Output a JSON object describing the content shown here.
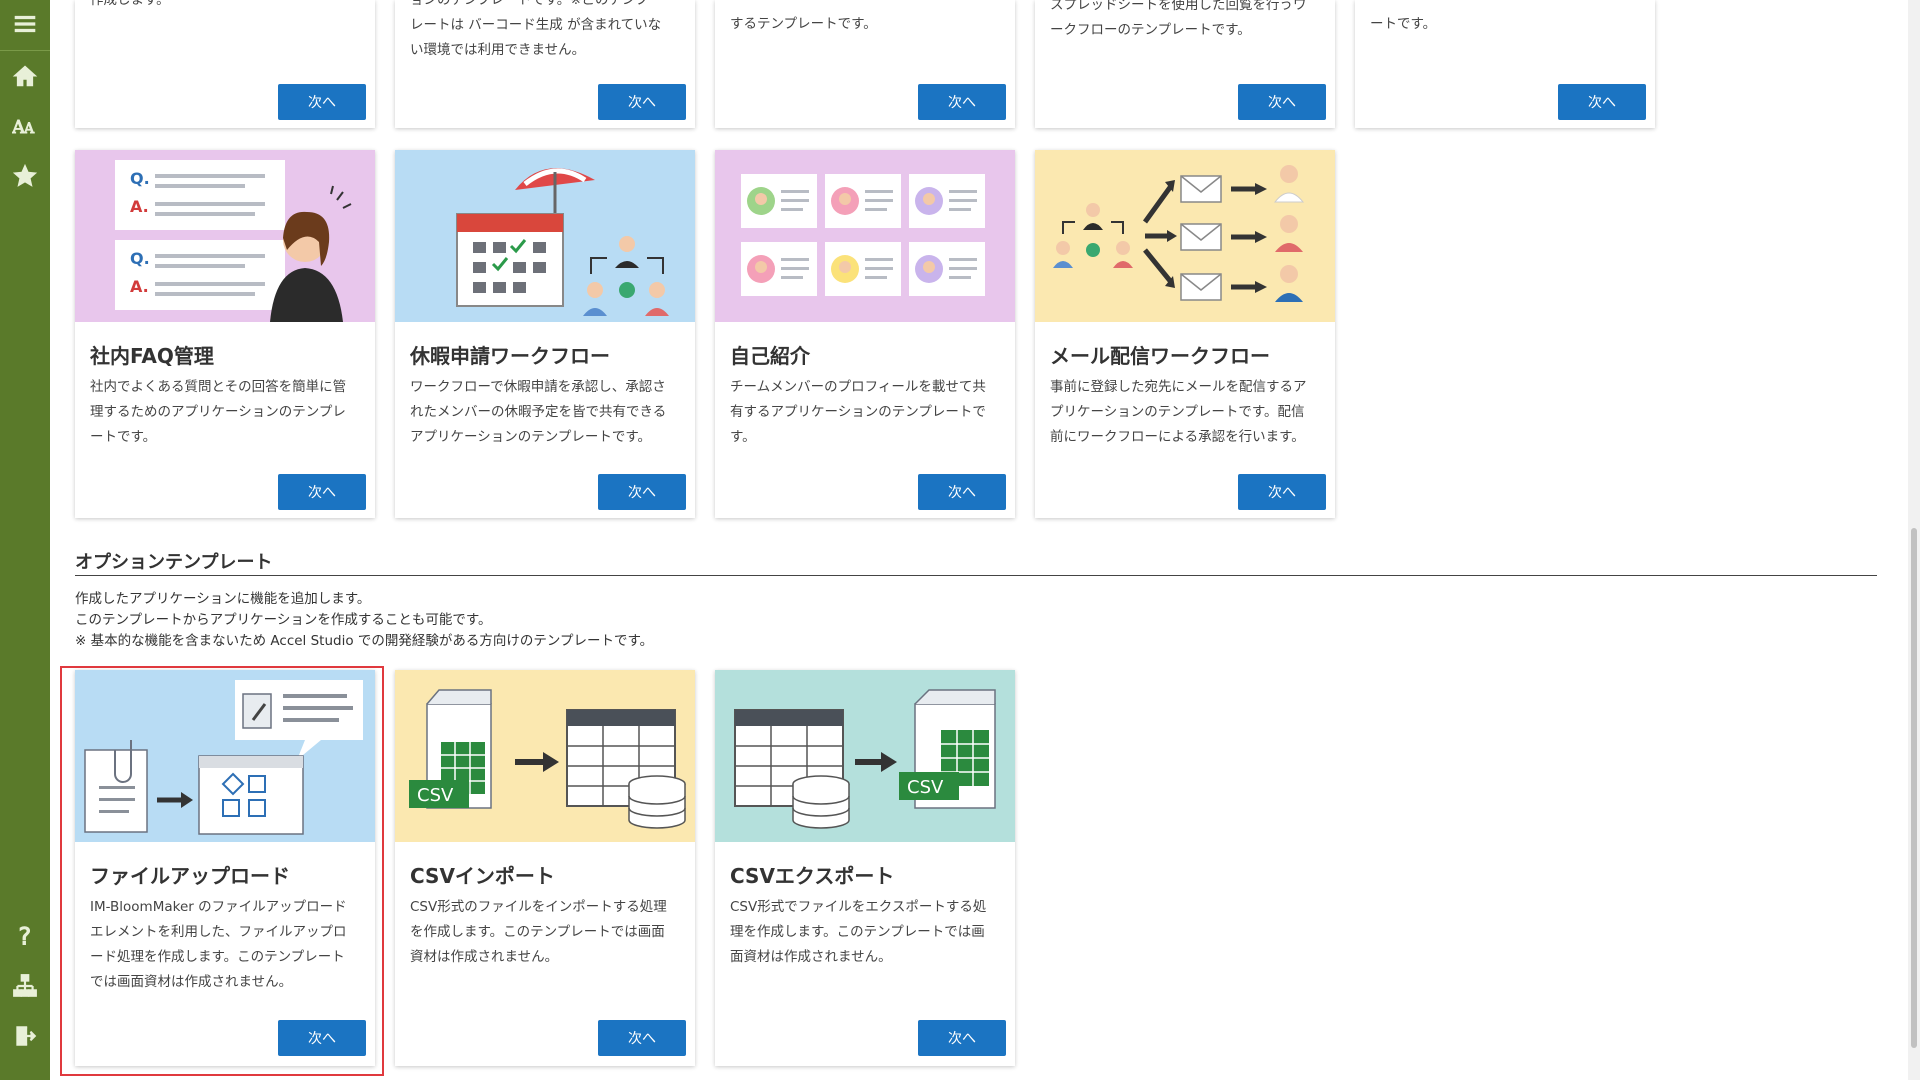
{
  "sidebar": {
    "items": [
      {
        "name": "menu",
        "label": "メニュー"
      },
      {
        "name": "home",
        "label": "ホーム"
      },
      {
        "name": "text",
        "label": "A"
      },
      {
        "name": "favorite",
        "label": "お気に入り"
      },
      {
        "name": "help",
        "label": "?"
      },
      {
        "name": "sitemap",
        "label": "サイトマップ"
      },
      {
        "name": "logout",
        "label": "ログアウト"
      }
    ]
  },
  "top_row": [
    {
      "desc_tail": "作成します。",
      "button": "次へ"
    },
    {
      "desc_tail": "ョンのテンプレートです。※このテンプ",
      "desc_tail2": "レートは バーコード生成 が含まれていな",
      "desc_tail3": "い環境では利用できません。",
      "button": "次へ"
    },
    {
      "desc_tail": "するテンプレートです。",
      "button": "次へ"
    },
    {
      "desc_tail": "スプレッドシートを使用した回覧を行うワ",
      "desc_tail2": "ークフローのテンプレートです。",
      "button": "次へ"
    },
    {
      "desc_tail": "ートです。",
      "button": "次へ"
    }
  ],
  "standard_cards": [
    {
      "title": "社内FAQ管理",
      "desc": [
        "社内でよくある質問とその回答を簡単に管",
        "理するためのアプリケーションのテンプレ",
        "ートです。"
      ],
      "button": "次へ",
      "icon": "faq-illustration",
      "bg": "#e8c6ec"
    },
    {
      "title": "休暇申請ワークフロー",
      "desc": [
        "ワークフローで休暇申請を承認し、承認さ",
        "れたメンバーの休暇予定を皆で共有できる",
        "アプリケーションのテンプレートです。"
      ],
      "button": "次へ",
      "icon": "vacation-illustration",
      "bg": "#b8dcf4"
    },
    {
      "title": "自己紹介",
      "desc": [
        "チームメンバーのプロフィールを載せて共",
        "有するアプリケーションのテンプレートで",
        "す。"
      ],
      "button": "次へ",
      "icon": "profile-illustration",
      "bg": "#e8c6ec"
    },
    {
      "title": "メール配信ワークフロー",
      "desc": [
        "事前に登録した宛先にメールを配信するア",
        "プリケーションのテンプレートです。配信",
        "前にワークフローによる承認を行います。"
      ],
      "button": "次へ",
      "icon": "mail-illustration",
      "bg": "#fbe8b0"
    }
  ],
  "option_section": {
    "title": "オプションテンプレート",
    "desc": [
      "作成したアプリケーションに機能を追加します。",
      "このテンプレートからアプリケーションを作成することも可能です。",
      "※ 基本的な機能を含まないため Accel Studio での開発経験がある方向けのテンプレートです。"
    ]
  },
  "option_cards": [
    {
      "title": "ファイルアップロード",
      "desc": [
        "IM-BloomMaker のファイルアップロード",
        "エレメントを利用した、ファイルアップロ",
        "ード処理を作成します。このテンプレート",
        "では画面資材は作成されません。"
      ],
      "button": "次へ",
      "icon": "file-upload-illustration",
      "bg": "#b8dcf4"
    },
    {
      "title": "CSVインポート",
      "desc": [
        "CSV形式のファイルをインポートする処理",
        "を作成します。このテンプレートでは画面",
        "資材は作成されません。"
      ],
      "button": "次へ",
      "icon": "csv-import-illustration",
      "bg": "#fbe8b0",
      "badge": "CSV"
    },
    {
      "title": "CSVエクスポート",
      "desc": [
        "CSV形式でファイルをエクスポートする処",
        "理を作成します。このテンプレートでは画",
        "面資材は作成されません。"
      ],
      "button": "次へ",
      "icon": "csv-export-illustration",
      "bg": "#b4e0dc",
      "badge": "CSV"
    }
  ],
  "colors": {
    "sidebar": "#5a7a2a",
    "button": "#1b74c2",
    "highlight": "#e0393e"
  }
}
